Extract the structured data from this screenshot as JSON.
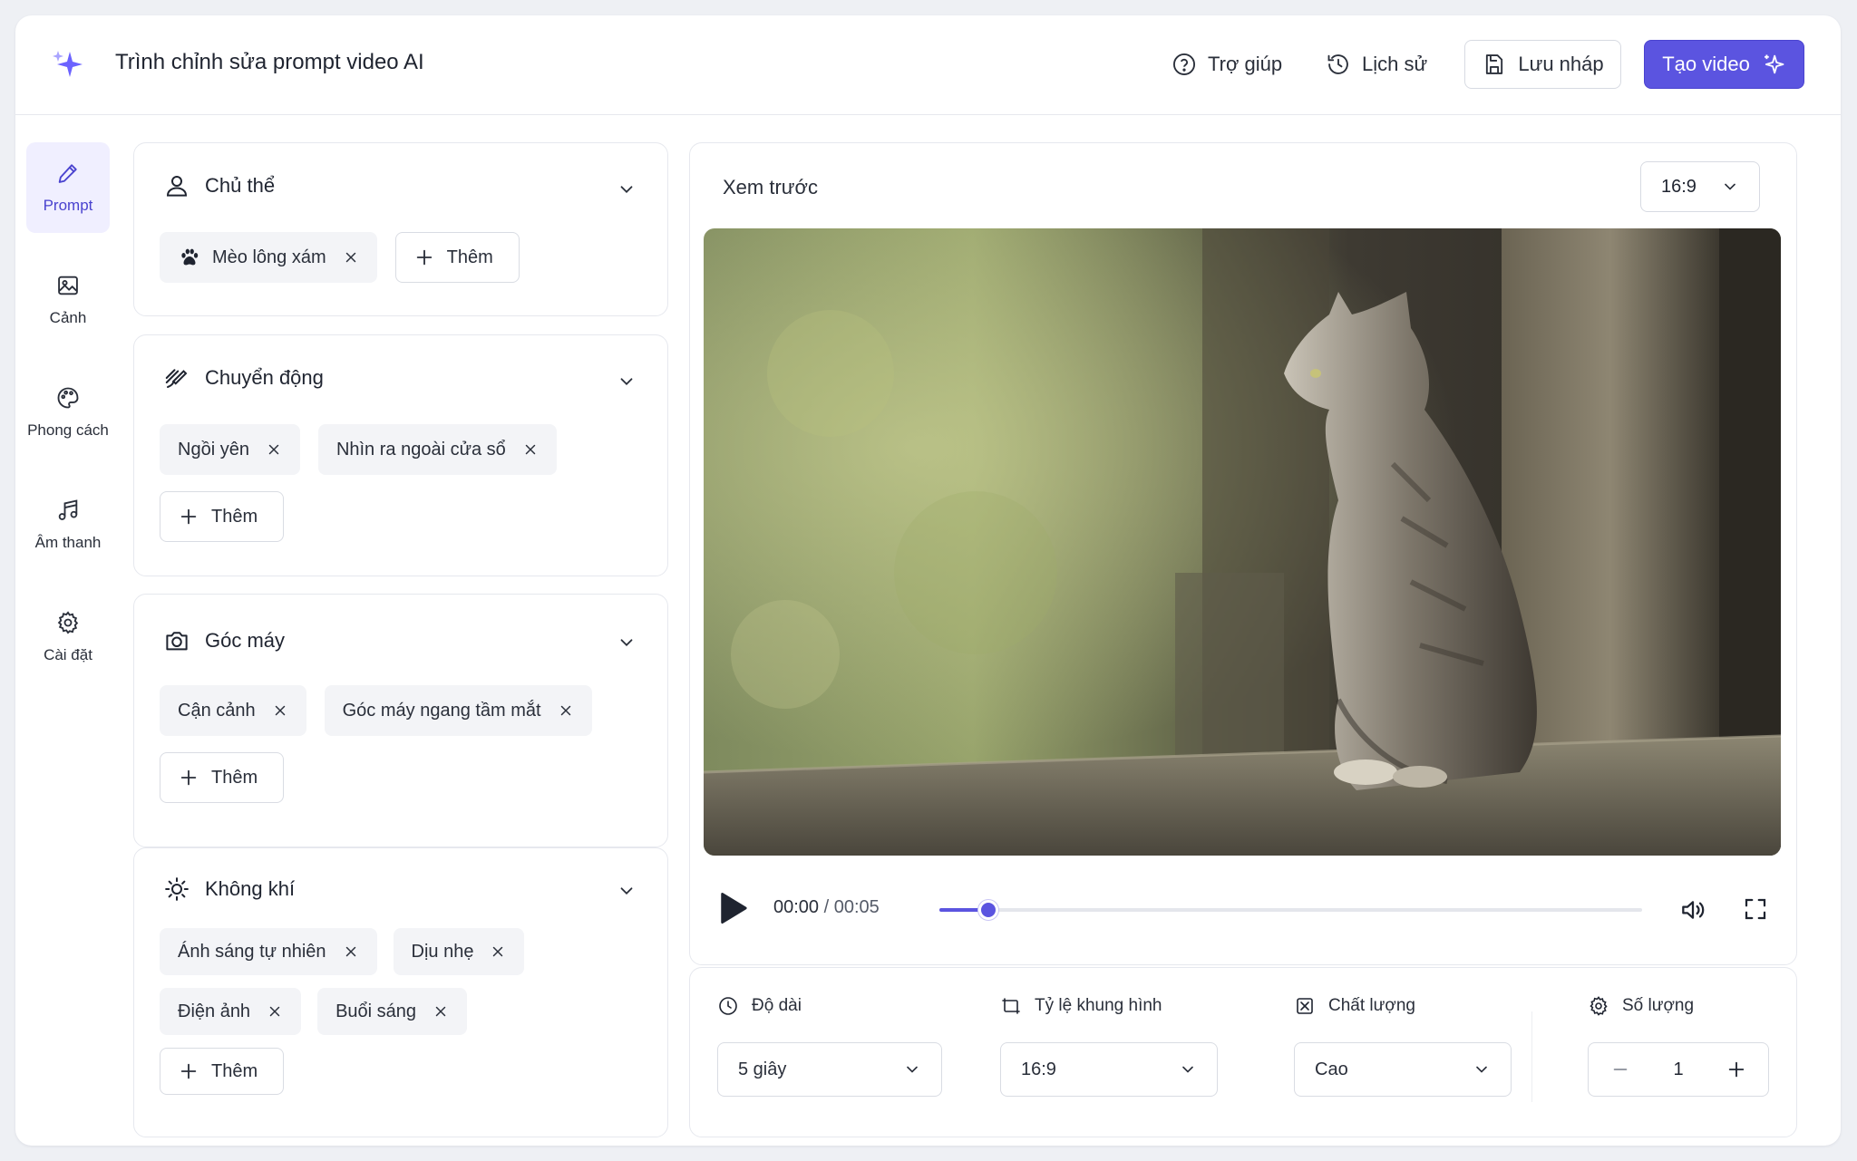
{
  "header": {
    "title": "Trình chỉnh sửa prompt video AI",
    "help_label": "Trợ giúp",
    "history_label": "Lịch sử",
    "draft_label": "Lưu nháp",
    "create_label": "Tạo video"
  },
  "nav": {
    "items": [
      {
        "label": "Prompt",
        "icon": "pencil-icon",
        "active": true
      },
      {
        "label": "Cảnh",
        "icon": "image-icon"
      },
      {
        "label": "Phong cách",
        "icon": "palette-icon"
      },
      {
        "label": "Âm thanh",
        "icon": "music-icon"
      },
      {
        "label": "Cài đặt",
        "icon": "gear-icon"
      }
    ]
  },
  "sections": {
    "subject": {
      "title": "Chủ thể",
      "chips": [
        "Mèo lông xám"
      ],
      "add_label": "Thêm"
    },
    "motion": {
      "title": "Chuyển động",
      "chips": [
        "Ngồi yên",
        "Nhìn ra ngoài cửa sổ"
      ],
      "add_label": "Thêm"
    },
    "camera": {
      "title": "Góc máy",
      "chips": [
        "Cận cảnh",
        "Góc máy ngang tầm mắt"
      ],
      "add_label": "Thêm"
    },
    "mood": {
      "title": "Không khí",
      "chips": [
        "Ánh sáng tự nhiên",
        "Dịu nhẹ",
        "Điện ảnh",
        "Buổi sáng"
      ],
      "add_label": "Thêm"
    }
  },
  "preview": {
    "title": "Xem trước",
    "ratio": "16:9",
    "current_time": "00:00",
    "separator": " / ",
    "duration": "00:05",
    "progress": 0.07
  },
  "settings": {
    "length": {
      "label": "Độ dài",
      "value": "5 giây"
    },
    "aspect": {
      "label": "Tỷ lệ khung hình",
      "value": "16:9"
    },
    "quality": {
      "label": "Chất lượng",
      "value": "Cao"
    },
    "count": {
      "label": "Số lượng",
      "value": "1"
    }
  },
  "colors": {
    "accent": "#5b54e0",
    "chip_bg": "#f3f4f7",
    "border": "#e6e8ee"
  }
}
